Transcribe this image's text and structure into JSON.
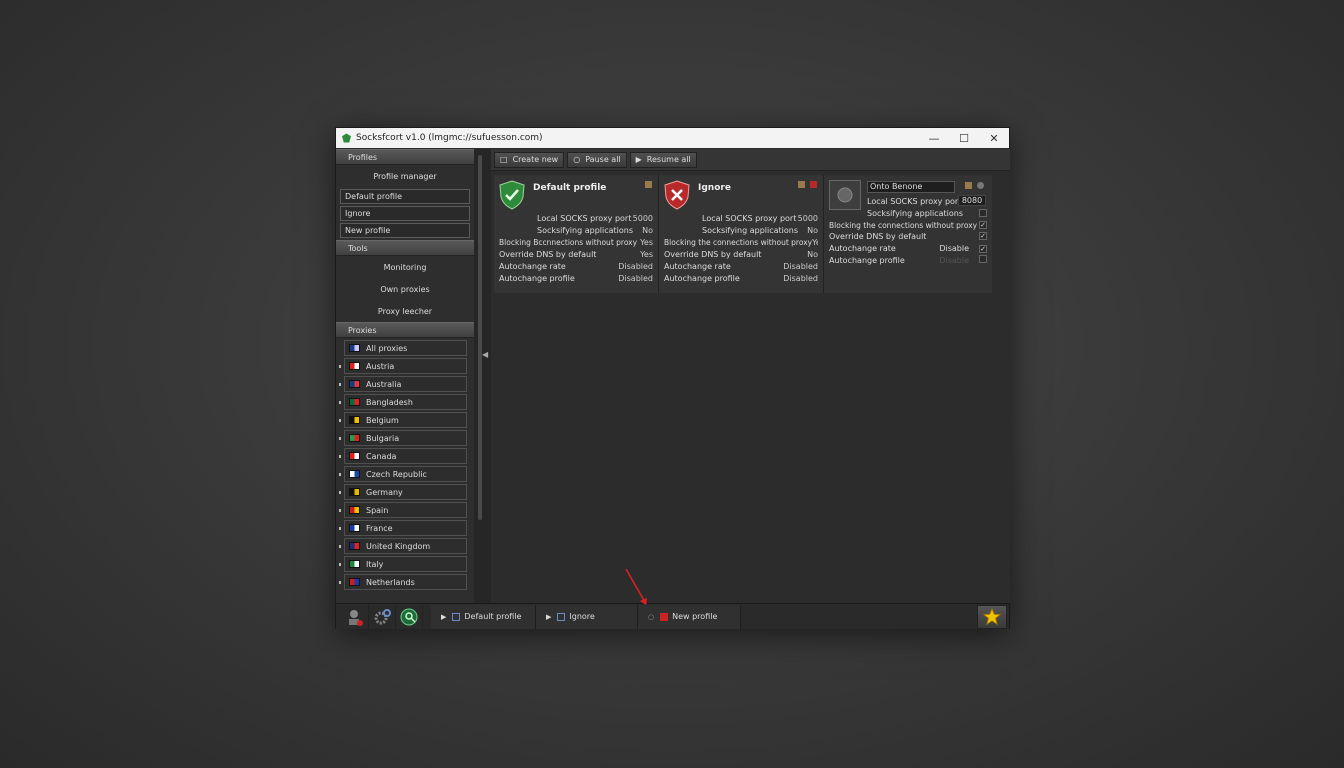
{
  "window": {
    "title": "Socksfcort v1.0 (lmgmc://sufuesson.com)",
    "minimize_icon": "minimize-icon",
    "maximize_icon": "maximize-icon",
    "close_icon": "close-icon"
  },
  "sidebar": {
    "profiles_header": "Profiles",
    "profile_manager": "Profile manager",
    "profiles": [
      "Default profile",
      "Ignore",
      "New profile"
    ],
    "tools_header": "Tools",
    "tools": [
      "Monitoring",
      "Own proxies",
      "Proxy leecher"
    ],
    "proxies_header": "Proxies",
    "countries": [
      {
        "name": "All proxies",
        "flag": [
          "#1a3a8a",
          "#c8c8ff"
        ]
      },
      {
        "name": "Austria",
        "flag": [
          "#d22",
          "#fff"
        ]
      },
      {
        "name": "Australia",
        "flag": [
          "#123f8a",
          "#e33"
        ]
      },
      {
        "name": "Bangladesh",
        "flag": [
          "#0a6b3a",
          "#d22"
        ]
      },
      {
        "name": "Belgium",
        "flag": [
          "#111",
          "#f2c200"
        ]
      },
      {
        "name": "Bulgaria",
        "flag": [
          "#2a9a4a",
          "#d22"
        ]
      },
      {
        "name": "Canada",
        "flag": [
          "#d22",
          "#fff"
        ]
      },
      {
        "name": "Czech Republic",
        "flag": [
          "#fff",
          "#1a4aa8"
        ]
      },
      {
        "name": "Germany",
        "flag": [
          "#111",
          "#e7b800"
        ]
      },
      {
        "name": "Spain",
        "flag": [
          "#c81e1e",
          "#f2c200"
        ]
      },
      {
        "name": "France",
        "flag": [
          "#1a3aa8",
          "#fff"
        ]
      },
      {
        "name": "United Kingdom",
        "flag": [
          "#1a2e78",
          "#d22"
        ]
      },
      {
        "name": "Italy",
        "flag": [
          "#1a8a3a",
          "#fff"
        ]
      },
      {
        "name": "Netherlands",
        "flag": [
          "#c81e1e",
          "#1a3aa8"
        ]
      }
    ]
  },
  "toolbar": {
    "create": "Create new",
    "pause": "Pause all",
    "resume": "Resume all"
  },
  "cards": [
    {
      "name": "Default profile",
      "color": "#2e8b3a",
      "rows": [
        [
          "Local SOCKS proxy port",
          "5000"
        ],
        [
          "Socksifying applications",
          "No"
        ],
        [
          "Blocking Bccnnections without proxy",
          "Yes"
        ],
        [
          "Override DNS by default",
          "Yes"
        ],
        [
          "Autochange rate",
          "Disabled"
        ],
        [
          "Autochange profile",
          "Disabled"
        ]
      ]
    },
    {
      "name": "Ignore",
      "color": "#b82a2a",
      "rows": [
        [
          "Local SOCKS proxy port",
          "5000"
        ],
        [
          "Socksifying applications",
          "No"
        ],
        [
          "Blocking the connections without proxy",
          "Yes"
        ],
        [
          "Override DNS by default",
          "No"
        ],
        [
          "Autochange rate",
          "Disabled"
        ],
        [
          "Autochange profile",
          "Disabled"
        ]
      ]
    }
  ],
  "new_card": {
    "name_value": "Onto Benone",
    "port_label": "Local SOCKS proxy port",
    "port_value": "8080",
    "socks_label": "Socksifying applications",
    "block_label": "Blocking the connections without proxy",
    "dns_label": "Override DNS by default",
    "rate_label": "Autochange rate",
    "rate_value": "Disable",
    "profile_label": "Autochange profile",
    "profile_value": "Disable"
  },
  "bottom": {
    "tabs": [
      "Default profile",
      "Ignore",
      "New profile"
    ]
  }
}
